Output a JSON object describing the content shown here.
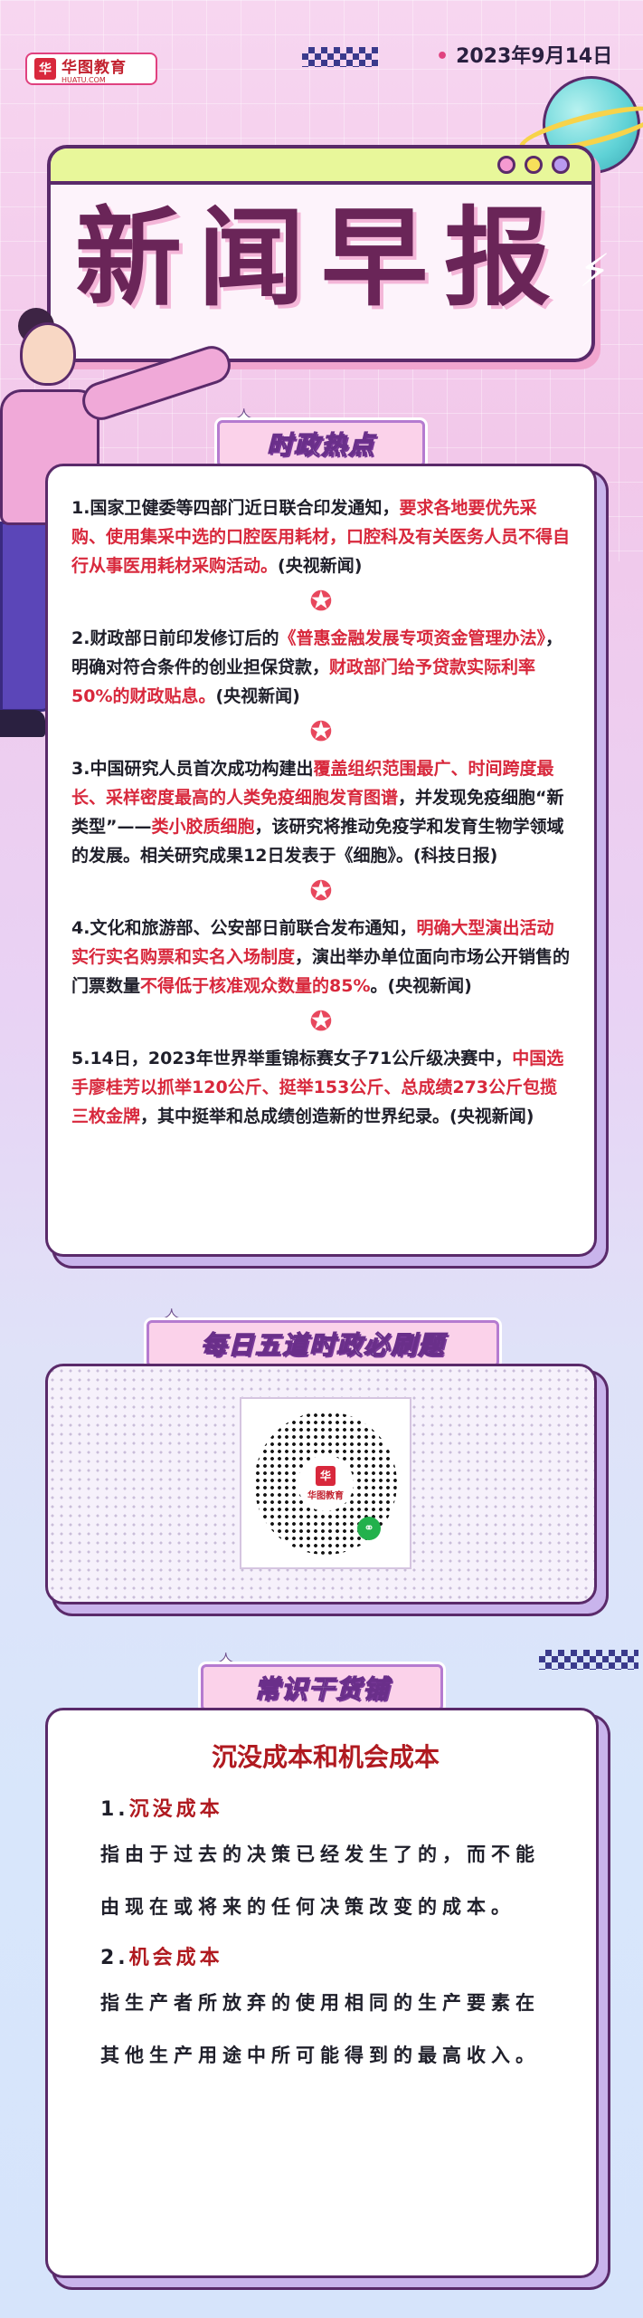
{
  "header": {
    "logo_name": "华图教育",
    "logo_domain": "HUATU.COM",
    "date": "2023年9月14日",
    "title": "新闻早报"
  },
  "sections": {
    "politics": "时政热点",
    "daily": "每日五道时政必刷题",
    "knowledge": "常识干货铺"
  },
  "news": [
    {
      "parts": [
        {
          "t": "1.国家卫健委等四部门近日联合印发通知，",
          "hl": false
        },
        {
          "t": "要求各地要优先采购、使用集采中选的口腔医用耗材，口腔科及有关医务人员不得自行从事医用耗材采购活动。",
          "hl": true
        },
        {
          "t": "(央视新闻)",
          "hl": false
        }
      ]
    },
    {
      "parts": [
        {
          "t": "2.财政部日前印发修订后的",
          "hl": false
        },
        {
          "t": "《普惠金融发展专项资金管理办法》",
          "hl": true
        },
        {
          "t": "，明确对符合条件的创业担保贷款，",
          "hl": false
        },
        {
          "t": "财政部门给予贷款实际利率50%的财政贴息。",
          "hl": true
        },
        {
          "t": "(央视新闻)",
          "hl": false
        }
      ]
    },
    {
      "parts": [
        {
          "t": "3.中国研究人员首次成功构建出",
          "hl": false
        },
        {
          "t": "覆盖组织范围最广、时间跨度最长、采样密度最高的人类免疫细胞发育图谱",
          "hl": true
        },
        {
          "t": "，并发现免疫细胞“新类型”——",
          "hl": false
        },
        {
          "t": "类小胶质细胞",
          "hl": true
        },
        {
          "t": "，该研究将推动免疫学和发育生物学领域的发展。相关研究成果12日发表于《细胞》。(科技日报)",
          "hl": false
        }
      ]
    },
    {
      "parts": [
        {
          "t": "4.文化和旅游部、公安部日前联合发布通知，",
          "hl": false
        },
        {
          "t": "明确大型演出活动实行实名购票和实名入场制度",
          "hl": true
        },
        {
          "t": "，演出举办单位面向市场公开销售的门票数量",
          "hl": false
        },
        {
          "t": "不得低于核准观众数量的85%",
          "hl": true
        },
        {
          "t": "。(央视新闻)",
          "hl": false
        }
      ]
    },
    {
      "parts": [
        {
          "t": "5.14日，2023年世界举重锦标赛女子71公斤级决赛中，",
          "hl": false
        },
        {
          "t": "中国选手廖桂芳以抓举120公斤、挺举153公斤、总成绩273公斤包揽三枚金牌",
          "hl": true
        },
        {
          "t": "，其中挺举和总成绩创造新的世界纪录。(央视新闻)",
          "hl": false
        }
      ]
    }
  ],
  "qr": {
    "brand": "华图教育"
  },
  "knowledge": {
    "title": "沉没成本和机会成本",
    "items": [
      {
        "num": "1.",
        "name": "沉没成本",
        "body": "指由于过去的决策已经发生了的，而不能由现在或将来的任何决策改变的成本。"
      },
      {
        "num": "2.",
        "name": "机会成本",
        "body": "指生产者所放弃的使用相同的生产要素在其他生产用途中所可能得到的最高收入。"
      }
    ]
  },
  "colors": {
    "highlight": "#d8283c",
    "title": "#6a2558",
    "knowledge_red": "#b01a20"
  },
  "icons": [
    "logo-mark-icon",
    "star-icon",
    "planet-icon",
    "lightning-icon",
    "sparkle-icon",
    "qr-code-icon",
    "mini-program-icon"
  ]
}
